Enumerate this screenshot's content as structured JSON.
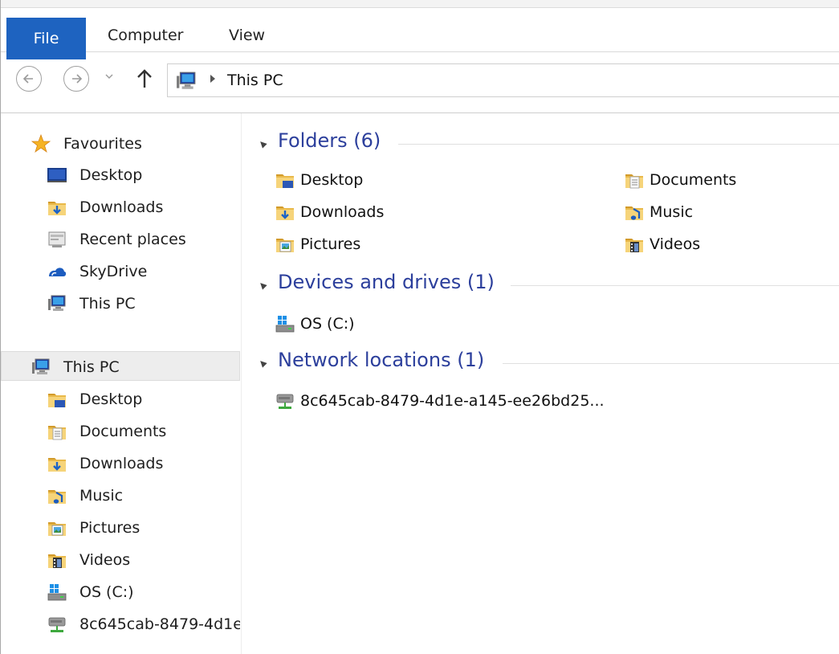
{
  "ribbon": {
    "tabs": [
      {
        "label": "File",
        "active": true
      },
      {
        "label": "Computer",
        "active": false
      },
      {
        "label": "View",
        "active": false
      }
    ],
    "accent_color": "#1e63c0"
  },
  "address": {
    "location_icon": "this-pc-icon",
    "path": [
      "This PC"
    ]
  },
  "nav": {
    "favourites": {
      "label": "Favourites",
      "items": [
        {
          "label": "Desktop",
          "icon": "desktop-icon"
        },
        {
          "label": "Downloads",
          "icon": "downloads-folder-icon"
        },
        {
          "label": "Recent places",
          "icon": "recent-places-icon"
        },
        {
          "label": "SkyDrive",
          "icon": "skydrive-icon"
        },
        {
          "label": "This PC",
          "icon": "this-pc-icon"
        }
      ]
    },
    "this_pc": {
      "label": "This PC",
      "selected": true,
      "items": [
        {
          "label": "Desktop",
          "icon": "desktop-folder-icon"
        },
        {
          "label": "Documents",
          "icon": "documents-folder-icon"
        },
        {
          "label": "Downloads",
          "icon": "downloads-folder-icon"
        },
        {
          "label": "Music",
          "icon": "music-folder-icon"
        },
        {
          "label": "Pictures",
          "icon": "pictures-folder-icon"
        },
        {
          "label": "Videos",
          "icon": "videos-folder-icon"
        },
        {
          "label": "OS (C:)",
          "icon": "drive-icon"
        },
        {
          "label": "8c645cab-8479-4d1e",
          "icon": "network-location-icon"
        }
      ]
    }
  },
  "content": {
    "groups": [
      {
        "title": "Folders (6)",
        "items": [
          {
            "label": "Desktop",
            "icon": "desktop-folder-icon"
          },
          {
            "label": "Documents",
            "icon": "documents-folder-icon"
          },
          {
            "label": "Downloads",
            "icon": "downloads-folder-icon"
          },
          {
            "label": "Music",
            "icon": "music-folder-icon"
          },
          {
            "label": "Pictures",
            "icon": "pictures-folder-icon"
          },
          {
            "label": "Videos",
            "icon": "videos-folder-icon"
          }
        ]
      },
      {
        "title": "Devices and drives (1)",
        "items": [
          {
            "label": "OS (C:)",
            "icon": "drive-icon"
          }
        ]
      },
      {
        "title": "Network locations (1)",
        "items": [
          {
            "label": "8c645cab-8479-4d1e-a145-ee26bd25...",
            "icon": "network-location-icon"
          }
        ]
      }
    ],
    "title_color": "#2c3f9c"
  }
}
